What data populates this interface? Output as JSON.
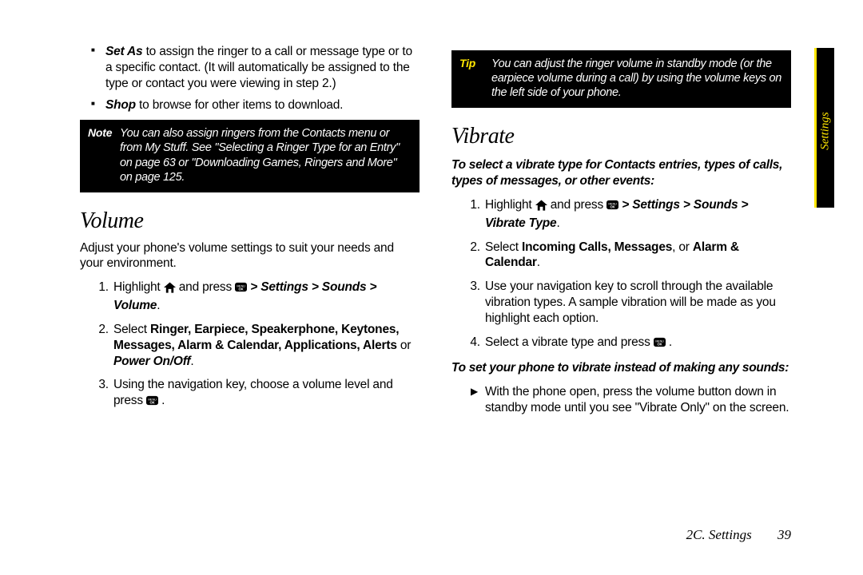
{
  "col1": {
    "bullets": {
      "setas_bold": "Set As",
      "setas_rest": " to assign the ringer to a call or message type or to a specific contact. (It will automatically be assigned to the type or contact you were viewing in step 2.)",
      "shop_bold": "Shop",
      "shop_rest": " to browse for other items to download."
    },
    "note": {
      "label": "Note",
      "body": "You can also assign ringers from the Contacts menu or from My Stuff. See \"Selecting a Ringer Type for an Entry\" on page 63 or \"Downloading Games, Ringers and More\" on page 125."
    },
    "volume": {
      "heading": "Volume",
      "intro": "Adjust your phone's volume settings to suit your needs and your environment.",
      "s1_a": "Highlight ",
      "s1_b": " and press ",
      "s1_path": " > Settings > Sounds > Volume",
      "s1_end": ".",
      "s2_a": "Select ",
      "s2_bold": "Ringer, Earpiece, Speakerphone, Keytones, Messages, Alarm & Calendar, Applications, Alerts",
      "s2_or": " or ",
      "s2_bold2": "Power On/Off",
      "s2_end": ".",
      "s3_a": "Using the navigation key, choose a volume level and press ",
      "s3_end": " ."
    }
  },
  "col2": {
    "tip": {
      "label": "Tip",
      "body": "You can adjust the ringer volume in standby mode (or the earpiece volume during a call) by using the volume keys on the left side of your phone."
    },
    "vibrate": {
      "heading": "Vibrate",
      "lead1": "To select a vibrate type for Contacts entries, types of calls, types of messages, or other events:",
      "s1_a": "Highlight ",
      "s1_b": " and press ",
      "s1_path": " > Settings > Sounds > Vibrate Type",
      "s1_end": ".",
      "s2_a": "Select ",
      "s2_bold": "Incoming Calls, Messages",
      "s2_mid": ", or ",
      "s2_bold2": "Alarm & Calendar",
      "s2_end": ".",
      "s3": "Use your navigation key to scroll through the available vibration types. A sample vibration will be made as you highlight each option.",
      "s4_a": "Select a vibrate type and press ",
      "s4_end": " .",
      "lead2": "To set your phone to vibrate instead of making any sounds:",
      "arrow": "With the phone open, press the volume button down in standby mode until you see \"Vibrate Only\" on the screen."
    }
  },
  "sidetab": "Settings",
  "footer": {
    "section": "2C. Settings",
    "page": "39"
  }
}
